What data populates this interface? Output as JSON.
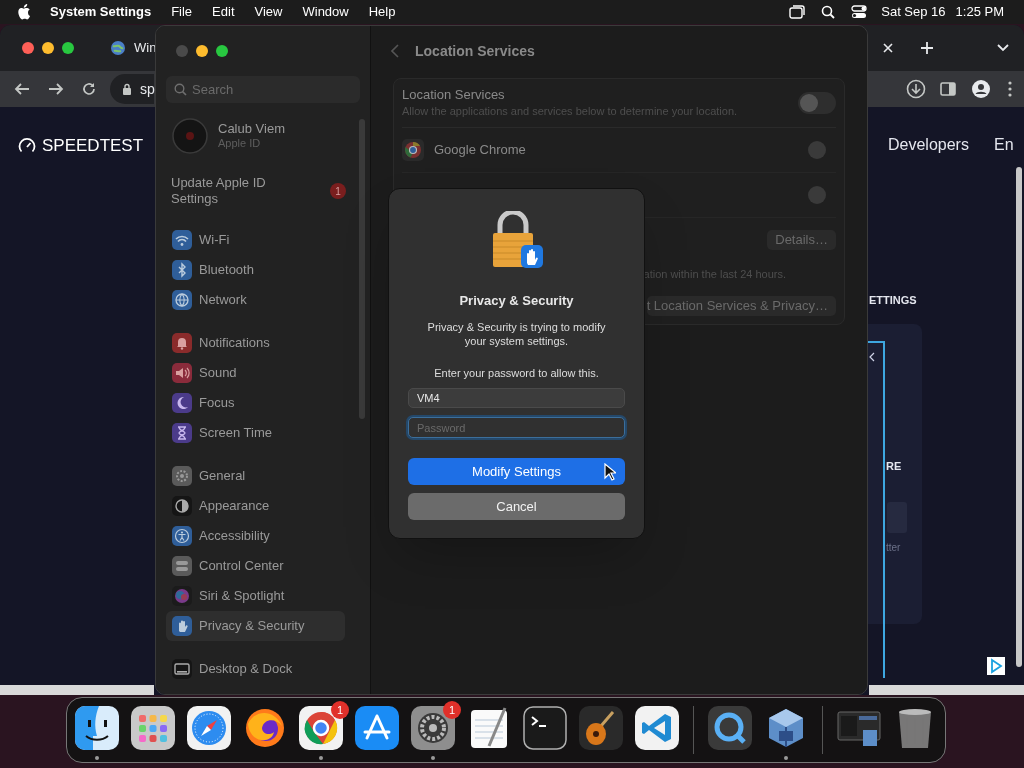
{
  "menu_bar": {
    "app": "System Settings",
    "menus": [
      "File",
      "Edit",
      "View",
      "Window",
      "Help"
    ],
    "date": "Sat Sep 16",
    "time": "1:25 PM"
  },
  "browser": {
    "tab_title": "Win",
    "address": "sp",
    "logo": "SPEEDTEST",
    "nav": [
      "Developers",
      "En"
    ],
    "section_heading": "ETTINGS",
    "fragments": [
      "RE",
      "tter"
    ]
  },
  "settings": {
    "search": {
      "placeholder": "Search"
    },
    "account": {
      "name": "Calub Viem",
      "subtitle": "Apple ID"
    },
    "update": {
      "label": "Update Apple ID Settings",
      "badge": "1"
    },
    "sidebar": [
      {
        "items": [
          {
            "kind": "wifi",
            "label": "Wi-Fi",
            "selected": false
          },
          {
            "kind": "bluetooth",
            "label": "Bluetooth",
            "selected": false
          },
          {
            "kind": "network",
            "label": "Network",
            "selected": false
          }
        ]
      },
      {
        "items": [
          {
            "kind": "notifications",
            "label": "Notifications",
            "selected": false
          },
          {
            "kind": "sound",
            "label": "Sound",
            "selected": false
          },
          {
            "kind": "focus",
            "label": "Focus",
            "selected": false
          },
          {
            "kind": "screentime",
            "label": "Screen Time",
            "selected": false
          }
        ]
      },
      {
        "items": [
          {
            "kind": "general",
            "label": "General",
            "selected": false
          },
          {
            "kind": "appearance",
            "label": "Appearance",
            "selected": false
          },
          {
            "kind": "accessibility",
            "label": "Accessibility",
            "selected": false
          },
          {
            "kind": "controlcenter",
            "label": "Control Center",
            "selected": false
          },
          {
            "kind": "siri",
            "label": "Siri & Spotlight",
            "selected": false
          },
          {
            "kind": "privacy",
            "label": "Privacy & Security",
            "selected": true
          }
        ]
      },
      {
        "items": [
          {
            "kind": "desktop",
            "label": "Desktop & Dock",
            "selected": false
          }
        ]
      }
    ],
    "pane": {
      "title": "Location Services",
      "location": {
        "title": "Location Services",
        "description": "Allow the applications and services below to determine your location.",
        "on": false
      },
      "rows": [
        {
          "kind": "app",
          "name": "Google Chrome",
          "on": false
        },
        {
          "kind": "covered",
          "on": false
        }
      ],
      "details_button": "Details…",
      "note": "ation within the last 24 hours.",
      "about_button": "t Location Services & Privacy…"
    }
  },
  "dialog": {
    "title": "Privacy & Security",
    "message": "Privacy & Security is trying to modify your system settings.",
    "prompt": "Enter your password to allow this.",
    "username": "VM4",
    "password": {
      "placeholder": "Password"
    },
    "buttons": [
      {
        "kind": "primary",
        "label": "Modify Settings"
      },
      {
        "kind": "secondary",
        "label": "Cancel"
      }
    ]
  },
  "dock": [
    {
      "items": [
        {
          "kind": "finder",
          "running": true
        },
        {
          "kind": "launchpad",
          "running": false
        },
        {
          "kind": "safari",
          "running": false
        },
        {
          "kind": "firefox",
          "running": false
        },
        {
          "kind": "chrome",
          "running": true,
          "badge": "1"
        },
        {
          "kind": "appstore",
          "running": false
        },
        {
          "kind": "settings",
          "running": true,
          "badge": "1"
        },
        {
          "kind": "textedit",
          "running": false
        },
        {
          "kind": "terminal",
          "running": false
        },
        {
          "kind": "garageband",
          "running": false
        },
        {
          "kind": "vscode",
          "running": false
        }
      ]
    },
    {
      "items": [
        {
          "kind": "quicktime",
          "running": false
        },
        {
          "kind": "virtualbox",
          "running": true
        }
      ]
    },
    {
      "items": [
        {
          "kind": "window",
          "running": false
        },
        {
          "kind": "trash",
          "running": false
        }
      ]
    }
  ]
}
